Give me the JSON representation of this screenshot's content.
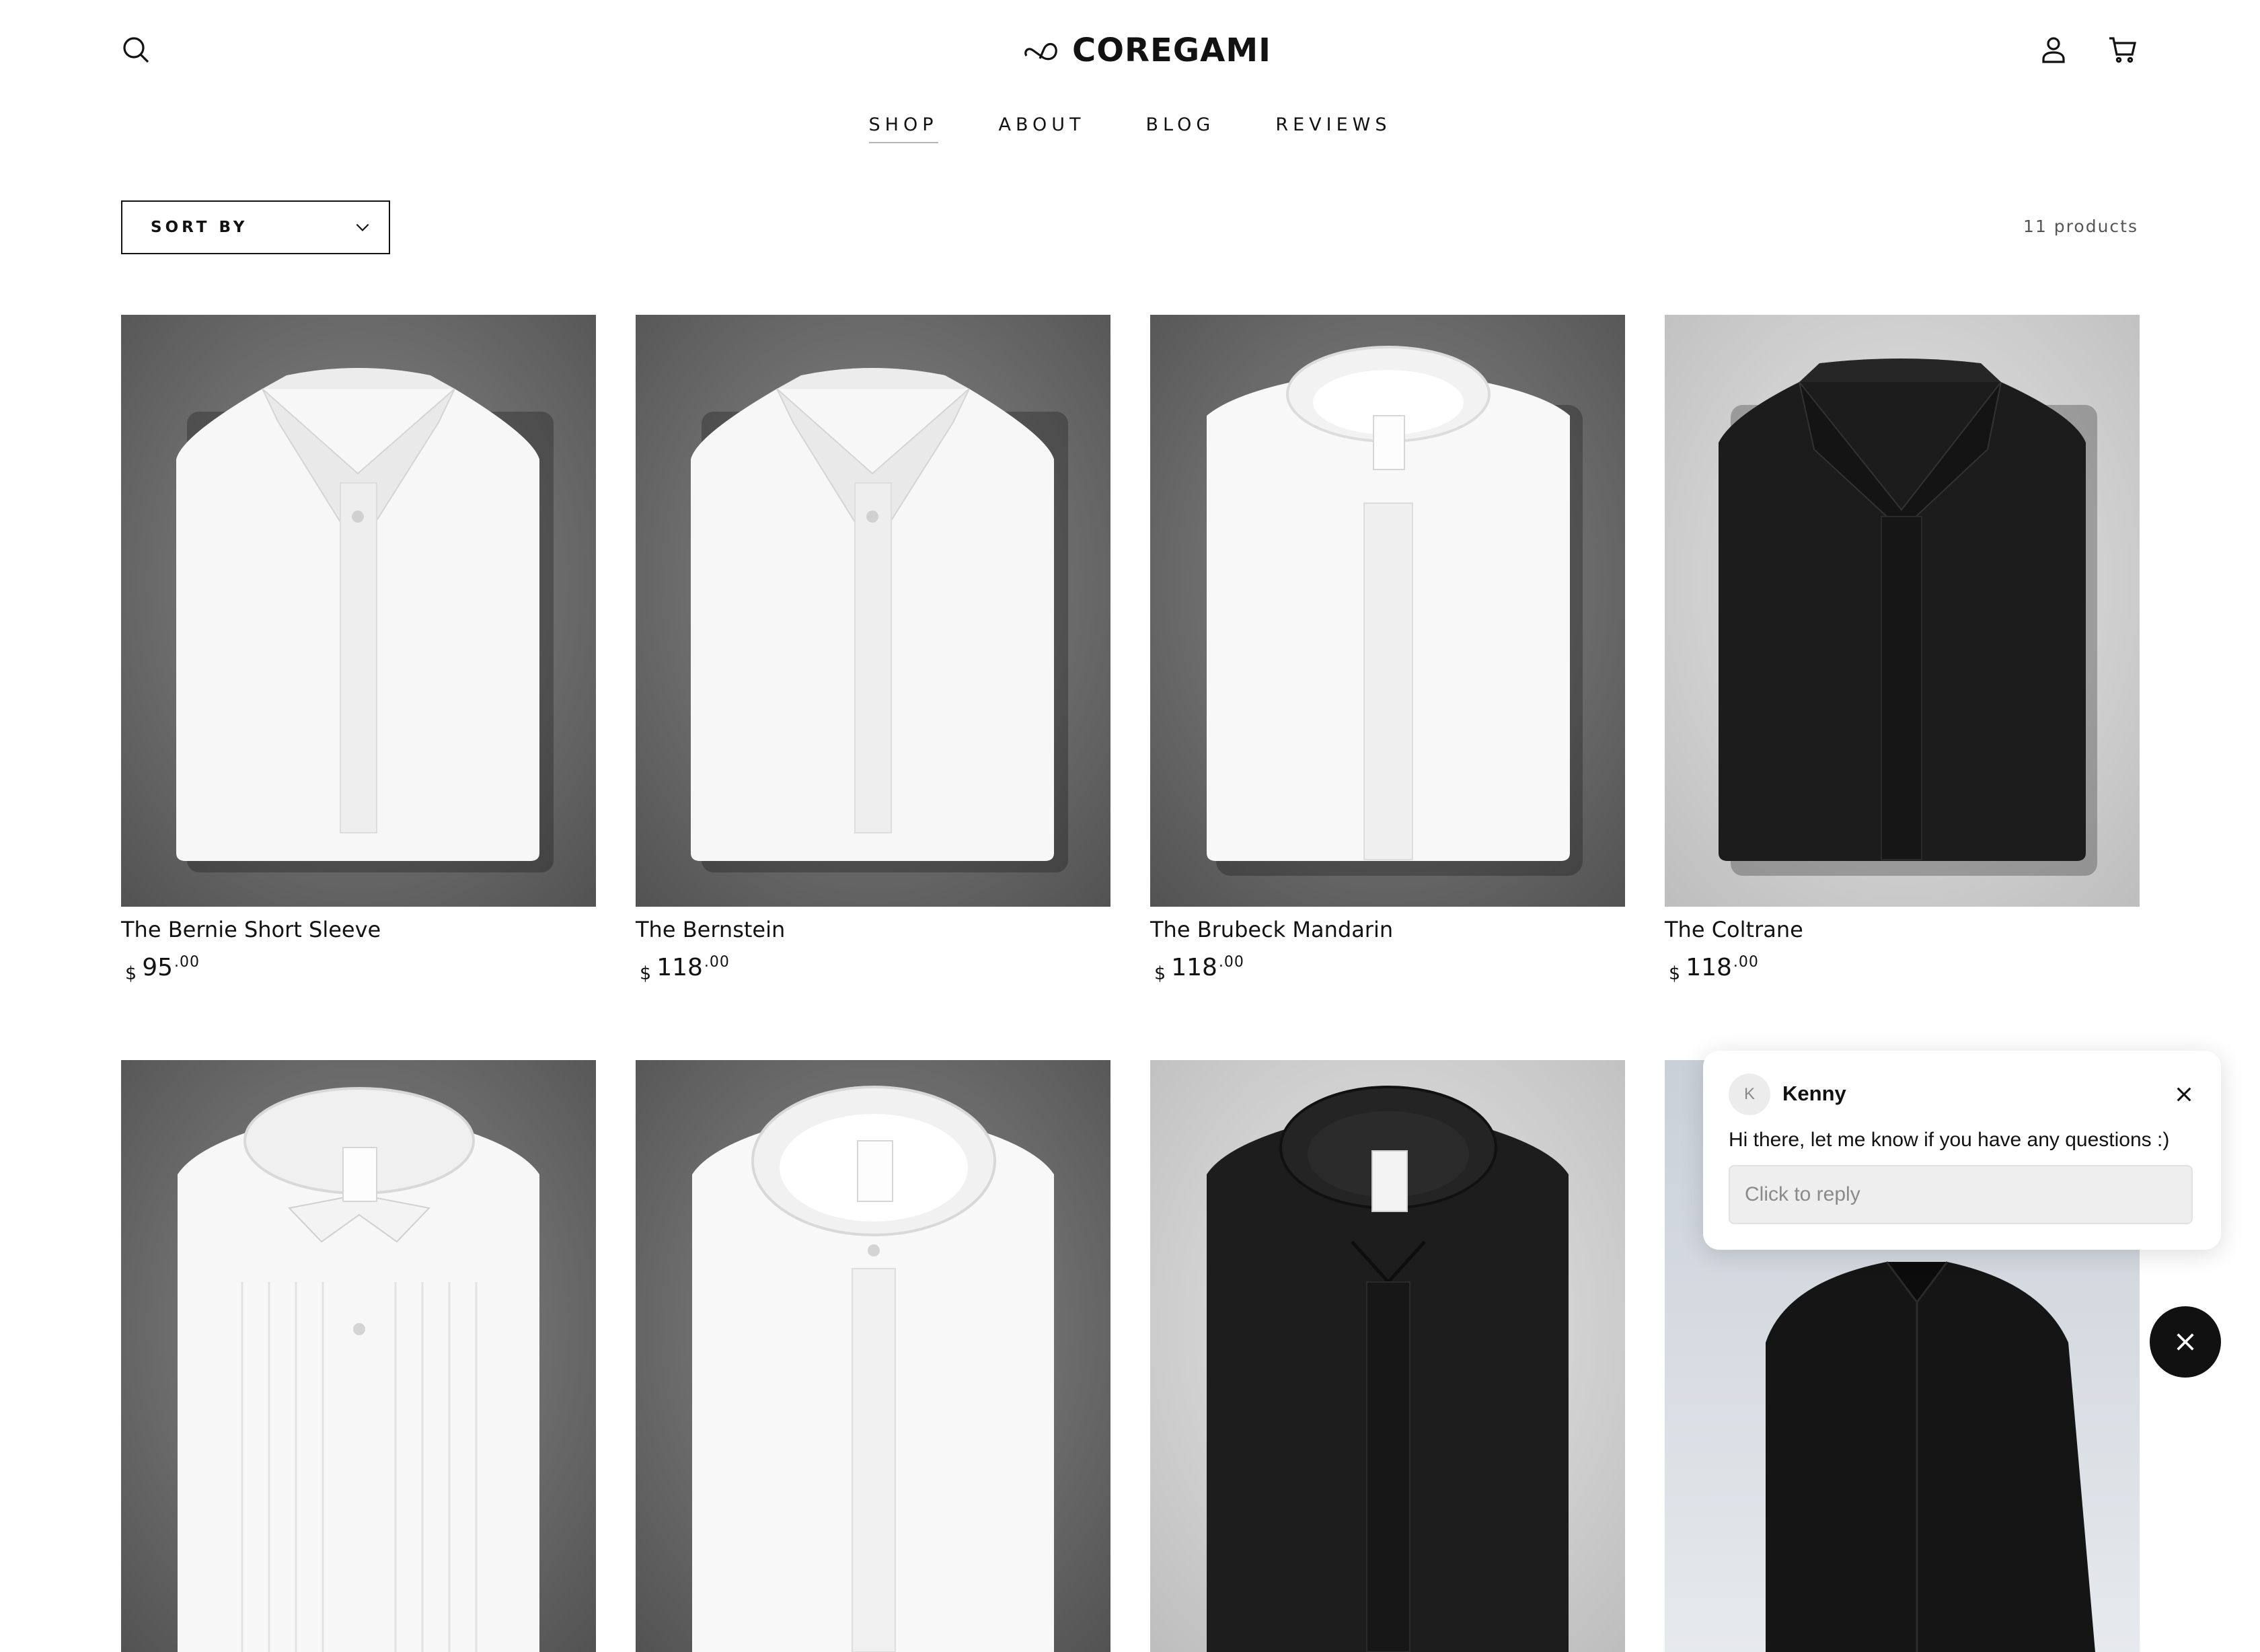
{
  "header": {
    "brand": "COREGAMI",
    "icons": {
      "search": "search-icon",
      "account": "user-icon",
      "cart": "cart-icon",
      "logo": "infinity-logo"
    }
  },
  "nav": {
    "items": [
      {
        "label": "SHOP",
        "active": true
      },
      {
        "label": "ABOUT",
        "active": false
      },
      {
        "label": "BLOG",
        "active": false
      },
      {
        "label": "REVIEWS",
        "active": false
      }
    ]
  },
  "toolbar": {
    "sort_label": "SORT BY",
    "product_count": "11 products"
  },
  "products": [
    {
      "title": "The Bernie Short Sleeve",
      "currency": "$",
      "price": "95",
      "cents": ".00",
      "color": "white"
    },
    {
      "title": "The Bernstein",
      "currency": "$",
      "price": "118",
      "cents": ".00",
      "color": "white"
    },
    {
      "title": "The Brubeck Mandarin",
      "currency": "$",
      "price": "118",
      "cents": ".00",
      "color": "white"
    },
    {
      "title": "The Coltrane",
      "currency": "$",
      "price": "118",
      "cents": ".00",
      "color": "black"
    },
    {
      "color": "white"
    },
    {
      "color": "white"
    },
    {
      "color": "black"
    },
    {
      "color": "black"
    }
  ],
  "chat": {
    "avatar_initial": "K",
    "agent_name": "Kenny",
    "message": "Hi there, let me know if you have any questions :)",
    "reply_placeholder": "Click to reply"
  }
}
